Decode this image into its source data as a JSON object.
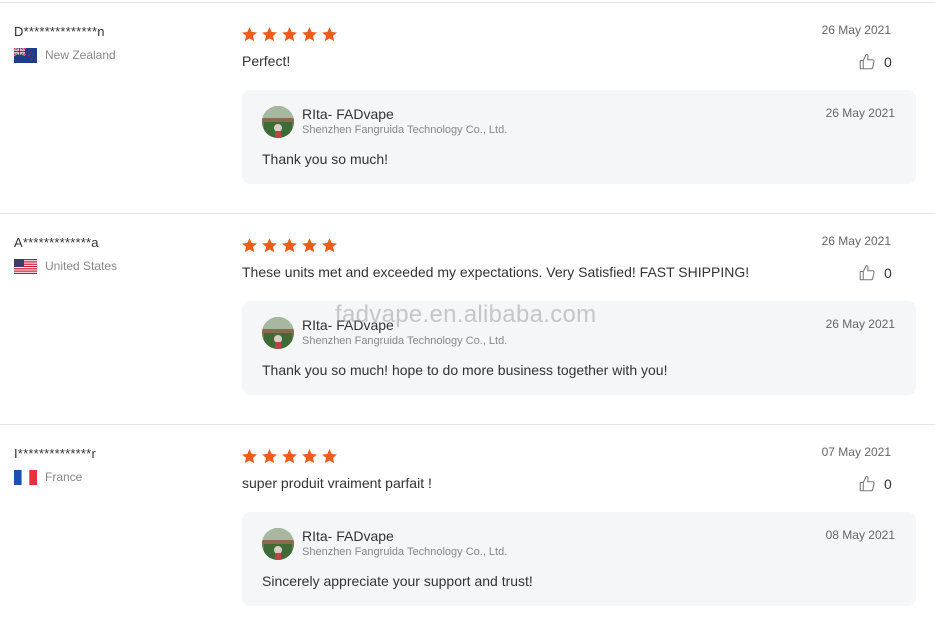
{
  "colors": {
    "star": "#f05a1a",
    "divider": "#e4e4e4",
    "reply_bg": "#f5f6f8"
  },
  "reviews": [
    {
      "reviewer": "D**************n",
      "country": "New Zealand",
      "flag_icon": "new-zealand-flag-icon",
      "rating": 5,
      "date": "26 May 2021",
      "text": "Perfect!",
      "likes": "0",
      "reply": {
        "seller": "RIta- FADvape",
        "company": "Shenzhen Fangruida Technology Co., Ltd.",
        "date": "26 May 2021",
        "text": "Thank you so much!"
      }
    },
    {
      "reviewer": "A*************a",
      "country": "United States",
      "flag_icon": "united-states-flag-icon",
      "rating": 5,
      "date": "26 May 2021",
      "text": "These units met and exceeded my expectations.  Very Satisfied!  FAST SHIPPING!",
      "likes": "0",
      "reply": {
        "seller": "RIta- FADvape",
        "company": "Shenzhen Fangruida Technology Co., Ltd.",
        "date": "26 May 2021",
        "text": "Thank you so much! hope to do more business together with you!"
      }
    },
    {
      "reviewer": "I**************r",
      "country": "France",
      "flag_icon": "france-flag-icon",
      "rating": 5,
      "date": "07 May 2021",
      "text": "super produit vraiment parfait !",
      "likes": "0",
      "reply": {
        "seller": "RIta- FADvape",
        "company": "Shenzhen Fangruida Technology Co., Ltd.",
        "date": "08 May 2021",
        "text": "Sincerely appreciate your support and trust!"
      }
    }
  ],
  "watermark": "fadvape.en.alibaba.com"
}
